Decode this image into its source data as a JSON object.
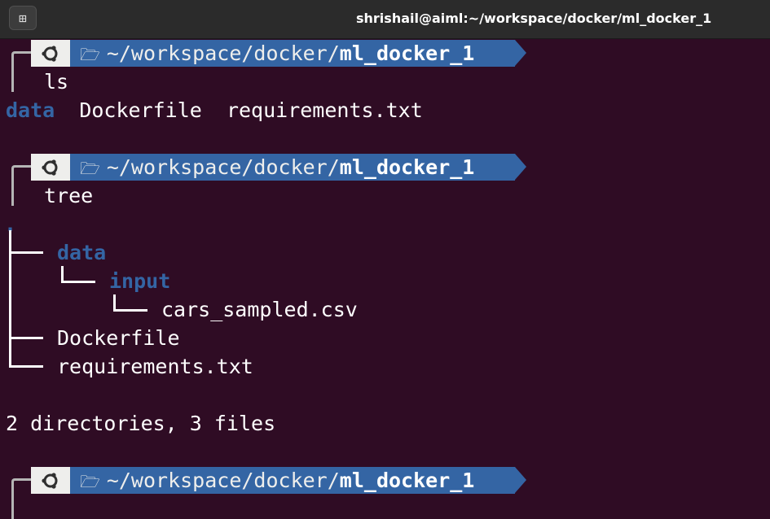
{
  "window": {
    "title": "shrishail@aiml:~/workspace/docker/ml_docker_1",
    "new_tab_icon": "new-tab-icon"
  },
  "prompt": {
    "os_icon": "ubuntu-logo-icon",
    "folder_icon": "folder-open-icon",
    "path_prefix": "~/workspace/docker/",
    "path_current": "ml_docker_1"
  },
  "session": {
    "cmd1": "ls",
    "ls_output": {
      "dir": "data",
      "file1": "Dockerfile",
      "file2": "requirements.txt"
    },
    "cmd2": "tree",
    "tree_root": ".",
    "tree": {
      "data": "data",
      "input": "input",
      "csv": "cars_sampled.csv",
      "dockerfile": "Dockerfile",
      "requirements": "requirements.txt"
    },
    "summary": "2 directories, 3 files"
  },
  "colors": {
    "background": "#2f0c24",
    "path_segment": "#3465a4",
    "directory": "#3465a4"
  }
}
